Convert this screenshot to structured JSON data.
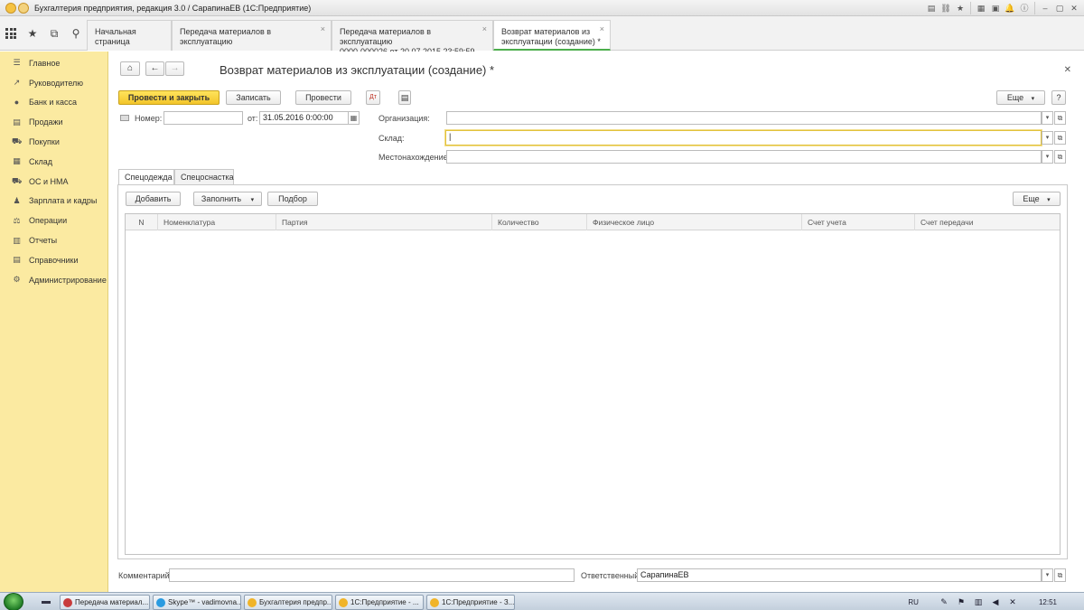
{
  "window": {
    "title": "Бухгалтерия предприятия, редакция 3.0 / СарапинаЕВ (1С:Предприятие)"
  },
  "tabs": [
    {
      "label": "Начальная страница"
    },
    {
      "label": "Передача материалов в эксплуатацию"
    },
    {
      "label_line1": "Передача материалов в эксплуатацию",
      "label_line2": "0000-000026 от 20.07.2015 23:59:59"
    },
    {
      "label_line1": "Возврат материалов из",
      "label_line2": "эксплуатации (создание) *"
    }
  ],
  "sidebar": {
    "items": [
      {
        "label": "Главное",
        "icon": "menu-icon"
      },
      {
        "label": "Руководителю",
        "icon": "trend-icon"
      },
      {
        "label": "Банк и касса",
        "icon": "coins-icon"
      },
      {
        "label": "Продажи",
        "icon": "cash-register-icon"
      },
      {
        "label": "Покупки",
        "icon": "cart-icon"
      },
      {
        "label": "Склад",
        "icon": "warehouse-icon"
      },
      {
        "label": "ОС и НМА",
        "icon": "truck-icon"
      },
      {
        "label": "Зарплата и кадры",
        "icon": "people-icon"
      },
      {
        "label": "Операции",
        "icon": "scales-icon"
      },
      {
        "label": "Отчеты",
        "icon": "chart-icon"
      },
      {
        "label": "Справочники",
        "icon": "book-icon"
      },
      {
        "label": "Администрирование",
        "icon": "gear-icon"
      }
    ]
  },
  "form": {
    "title": "Возврат материалов из эксплуатации (создание) *",
    "toolbar": {
      "post_and_close": "Провести и закрыть",
      "save": "Записать",
      "post": "Провести",
      "more": "Еще",
      "more_arrow": "▾",
      "help": "?"
    },
    "fields": {
      "number_label": "Номер:",
      "number_value": "",
      "date_label": "от:",
      "date_value": "31.05.2016  0:00:00",
      "organization_label": "Организация:",
      "organization_value": "",
      "warehouse_label": "Склад:",
      "warehouse_value": "|",
      "location_label": "Местонахождение:",
      "location_value": "",
      "comment_label": "Комментарий:",
      "comment_value": "",
      "responsible_label": "Ответственный:",
      "responsible_value": "СарапинаЕВ"
    },
    "form_tabs": [
      {
        "label": "Спецодежда"
      },
      {
        "label": "Спецоснастка"
      }
    ],
    "table_toolbar": {
      "add": "Добавить",
      "fill": "Заполнить",
      "fill_arrow": "▾",
      "select": "Подбор",
      "more": "Еще",
      "more_arrow": "▾"
    },
    "table_columns": [
      "N",
      "Номенклатура",
      "Партия",
      "Количество",
      "Физическое лицо",
      "Счет учета",
      "Счет передачи"
    ]
  },
  "taskbar": {
    "items": [
      {
        "label": "Передача материал...",
        "color": "#c83c3c"
      },
      {
        "label": "Skype™ - vadimovna...",
        "color": "#2a9be0"
      },
      {
        "label": "Бухгалтерия предпр...",
        "color": "#f0b429"
      },
      {
        "label": "1С:Предприятие - ...",
        "color": "#f0b429"
      },
      {
        "label": "1С:Предприятие - З...",
        "color": "#f0b429"
      }
    ],
    "lang": "RU",
    "clock": "12:51"
  },
  "colors": {
    "sidebar_bg": "#fbeaa1",
    "primary_button": "#f3c52a",
    "active_tab_underline": "#4cae4c"
  }
}
